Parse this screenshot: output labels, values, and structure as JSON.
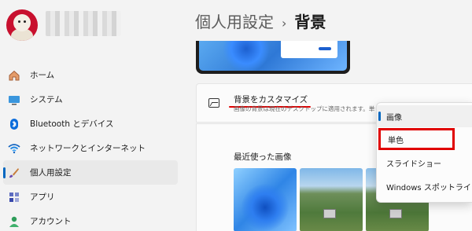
{
  "sidebar": {
    "items": [
      {
        "label": "ホーム",
        "icon": "home-icon"
      },
      {
        "label": "システム",
        "icon": "monitor-icon"
      },
      {
        "label": "Bluetooth とデバイス",
        "icon": "bluetooth-icon"
      },
      {
        "label": "ネットワークとインターネット",
        "icon": "wifi-icon"
      },
      {
        "label": "個人用設定",
        "icon": "brush-icon",
        "active": true
      },
      {
        "label": "アプリ",
        "icon": "apps-icon"
      },
      {
        "label": "アカウント",
        "icon": "person-icon"
      }
    ]
  },
  "header": {
    "section": "個人用設定",
    "separator": "›",
    "page": "背景"
  },
  "customize": {
    "title": "背景をカスタマイズ",
    "description": "画像の背景は現在のデスクトップに適用されます。単色またはスライドショーの背景は、すべてのデスクトップに適用されます。"
  },
  "recent": {
    "label": "最近使った画像"
  },
  "dropdown": {
    "options": [
      "画像",
      "単色",
      "スライドショー",
      "Windows スポットライト"
    ],
    "selected": "画像",
    "highlighted": "単色"
  },
  "colors": {
    "accent": "#0067c0",
    "highlight_red": "#e00000"
  }
}
